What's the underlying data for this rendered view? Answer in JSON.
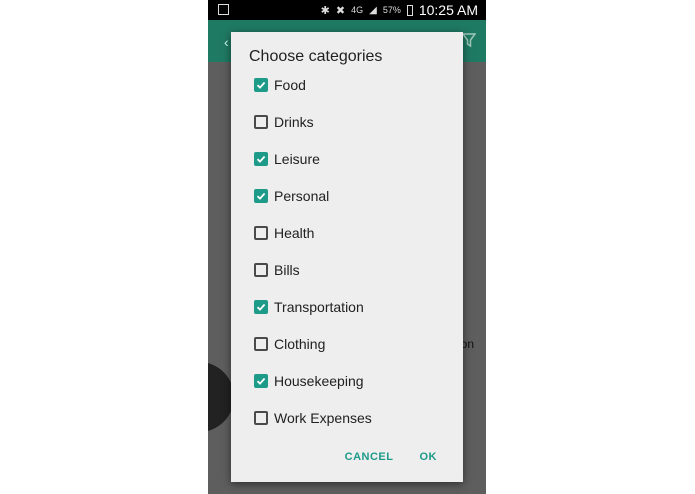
{
  "status_bar": {
    "network": "4G",
    "battery": "57%",
    "time": "10:25 AM"
  },
  "dialog": {
    "title": "Choose categories",
    "accent_color": "#1e9a88",
    "categories": [
      {
        "label": "Food",
        "checked": true
      },
      {
        "label": "Drinks",
        "checked": false
      },
      {
        "label": "Leisure",
        "checked": true
      },
      {
        "label": "Personal",
        "checked": true
      },
      {
        "label": "Health",
        "checked": false
      },
      {
        "label": "Bills",
        "checked": false
      },
      {
        "label": "Transportation",
        "checked": true
      },
      {
        "label": "Clothing",
        "checked": false
      },
      {
        "label": "Housekeeping",
        "checked": true
      },
      {
        "label": "Work Expenses",
        "checked": false
      }
    ],
    "cancel_label": "CANCEL",
    "ok_label": "OK"
  },
  "background": {
    "partial_text": "on"
  }
}
